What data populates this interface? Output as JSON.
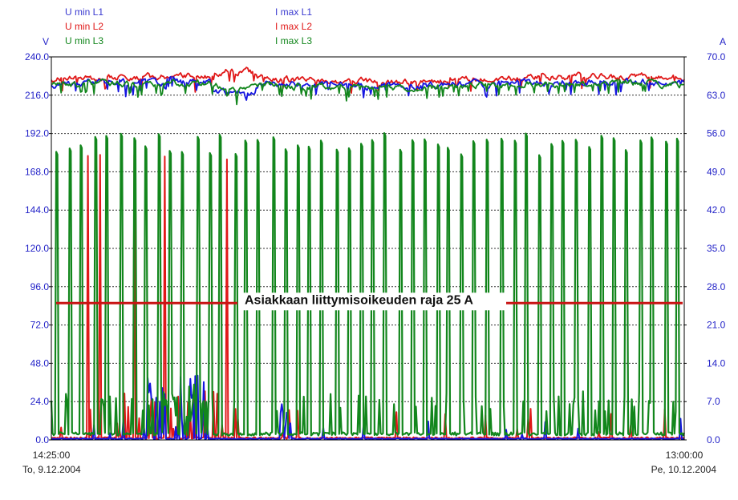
{
  "colors": {
    "l1": "#1515e0",
    "l2": "#e01818",
    "l3": "#12861c",
    "tick": "#2323c8",
    "limit_line": "#c81414"
  },
  "legend": {
    "left": [
      {
        "label": "U min L1",
        "color": "#3a3ad0"
      },
      {
        "label": "U min L2",
        "color": "#e01818"
      },
      {
        "label": "U min L3",
        "color": "#12861c"
      }
    ],
    "right": [
      {
        "label": "I max L1",
        "color": "#3a3ad0"
      },
      {
        "label": "I max L2",
        "color": "#e01818"
      },
      {
        "label": "I max L3",
        "color": "#12861c"
      }
    ]
  },
  "x_axis": {
    "start_time": "14:25:00",
    "start_date": "To, 9.12.2004",
    "end_time": "13:00:00",
    "end_date": "Pe, 10.12.2004"
  },
  "chart_data": {
    "type": "line",
    "title": "",
    "grid": "horizontal dotted",
    "y_left": {
      "unit": "V",
      "ylim": [
        0,
        240
      ],
      "ticks": [
        "0.0",
        "24.0",
        "48.0",
        "72.0",
        "96.0",
        "120.0",
        "144.0",
        "168.0",
        "192.0",
        "216.0",
        "240.0"
      ]
    },
    "y_right": {
      "unit": "A",
      "ylim": [
        0,
        70
      ],
      "ticks": [
        "0.0",
        "7.0",
        "14.0",
        "21.0",
        "28.0",
        "35.0",
        "42.0",
        "49.0",
        "56.0",
        "63.0",
        "70.0"
      ]
    },
    "x_range": [
      "14:25:00",
      "13:00:00"
    ],
    "series": [
      {
        "name": "U min L1",
        "axis": "left",
        "approx_level": 221,
        "approx_range": [
          213,
          228
        ]
      },
      {
        "name": "U min L2",
        "axis": "left",
        "approx_level": 225,
        "approx_range": [
          220,
          233
        ]
      },
      {
        "name": "U min L3",
        "axis": "left",
        "approx_level": 222,
        "approx_range": [
          214,
          227
        ]
      },
      {
        "name": "I max L1",
        "axis": "right",
        "baseline": 0.1,
        "max": 14
      },
      {
        "name": "I max L2",
        "axis": "right",
        "baseline": 0.2,
        "max": 54
      },
      {
        "name": "I max L3",
        "axis": "right",
        "baseline": 1.0,
        "max": 57,
        "spike_level": 56
      }
    ],
    "annotation": {
      "text": "Asiakkaan liittymisoikeuden raja 25 A",
      "value": 25,
      "axis": "right"
    }
  }
}
